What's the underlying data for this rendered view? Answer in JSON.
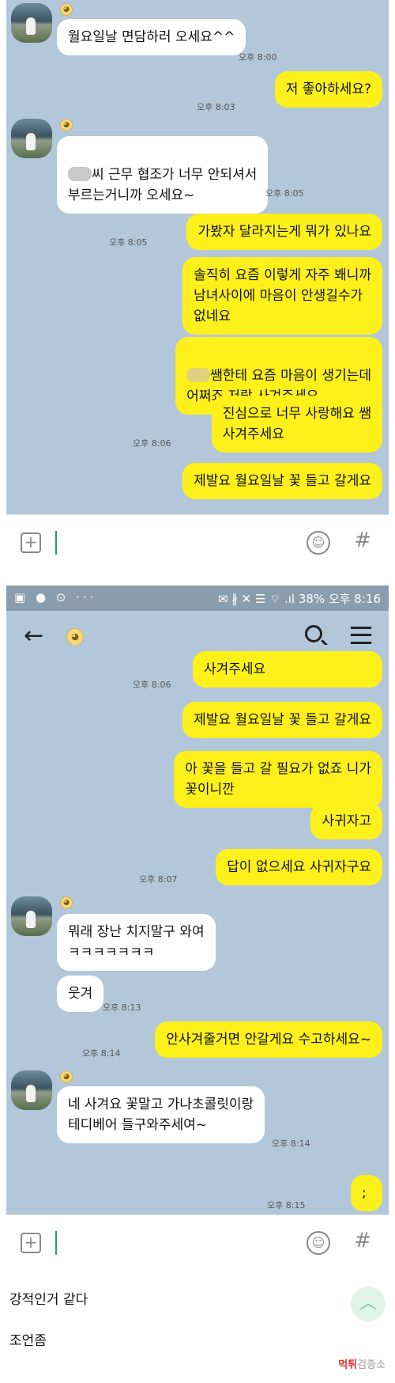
{
  "screen1": {
    "messages": [
      {
        "side": "left",
        "text": "월요일날 면담하러 오세요^^",
        "time": "오후 8:00"
      },
      {
        "side": "right",
        "text": "저 좋아하세요?",
        "time": "오후 8:03"
      },
      {
        "side": "left",
        "text_after_blur": "씨 근무 협조가 너무 안되셔서\n부르는거니까 오세요~",
        "time": "오후 8:05"
      },
      {
        "side": "right",
        "text": "가봤자 달라지는게 뭐가 있나요",
        "time": "오후 8:05"
      },
      {
        "side": "right",
        "text": "솔직히 요즘 이렇게 자주 봬니까\n남녀사이에 마음이 안생길수가\n없네요"
      },
      {
        "side": "right",
        "text_after_blur": "쌤한테 요즘 마음이 생기는데\n어쩌죠 저랑 사겨주세요"
      },
      {
        "side": "right",
        "text": "진심으로 너무 사랑해요 쌤\n사겨주세요",
        "time": "오후 8:06"
      },
      {
        "side": "right",
        "text": "제발요 월요일날 꽃 들고 갈게요"
      }
    ]
  },
  "inputbar": {
    "plus_icon": "plus-icon",
    "emoji_icon": "emoji-icon",
    "hash_label": "#"
  },
  "statusbar": {
    "left_icons": "▣ ● ⊙ ···",
    "right_text": "✉ ∦ ✕ ☰ ⌔ .ıl 38% 오후 8:16"
  },
  "header": {
    "back_icon": "back-arrow-icon",
    "search_icon": "search-icon",
    "menu_icon": "menu-icon"
  },
  "screen2": {
    "messages": [
      {
        "side": "right",
        "text": "사겨주세요",
        "time": "오후 8:06"
      },
      {
        "side": "right",
        "text": "제발요 월요일날 꽃 들고 갈게요"
      },
      {
        "side": "right",
        "text": "아 꽃을 들고 갈 필요가 없죠 니가\n꽃이니깐"
      },
      {
        "side": "right",
        "text": "사귀자고"
      },
      {
        "side": "right",
        "text": "답이 없으세요 사귀자구요",
        "time": "오후 8:07"
      },
      {
        "side": "left",
        "text": "뭐래 장난 치지말구 와여\nㅋㅋㅋㅋㅋㅋㅋ"
      },
      {
        "side": "left",
        "text": "웃겨",
        "time": "오후 8:13"
      },
      {
        "side": "right",
        "text": "안사겨줄거면 안갈게요 수고하세요~",
        "time": "오후 8:14"
      },
      {
        "side": "left",
        "text": "네 사겨요 꽃말고 가나초콜릿이랑\n테디베어 들구와주세여~",
        "time": "오후 8:14"
      },
      {
        "side": "right",
        "text": ";",
        "time": "오후 8:15"
      }
    ]
  },
  "post": {
    "line1": "강적인거 같다",
    "line2": "조언좀"
  },
  "watermark": {
    "brand": "먹튀",
    "suffix": "검증소"
  },
  "colors": {
    "chat_bg": "#b2c7d9",
    "my_bubble": "#fef01b",
    "their_bubble": "#ffffff"
  }
}
